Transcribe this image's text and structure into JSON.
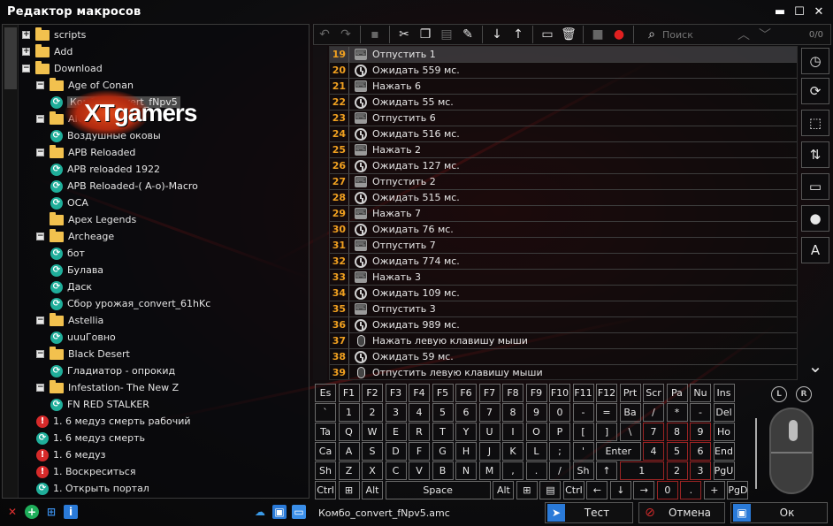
{
  "window": {
    "title": "Редактор макросов",
    "minimize": "▬",
    "maximize": "☐",
    "close": "✕"
  },
  "logo": {
    "text": "XTgamers"
  },
  "tree": {
    "items": [
      {
        "label": "scripts",
        "type": "folder",
        "exp": "+",
        "level": 0
      },
      {
        "label": "Add",
        "type": "folder",
        "exp": "+",
        "level": 0
      },
      {
        "label": "Download",
        "type": "folder",
        "exp": "−",
        "level": 0
      },
      {
        "label": "Age of Conan",
        "type": "folder",
        "exp": "−",
        "level": 1
      },
      {
        "label": "Комбо_convert_fNpv5",
        "type": "macro",
        "level": 2,
        "selected": true
      },
      {
        "label": "AION",
        "type": "folder",
        "exp": "−",
        "level": 1
      },
      {
        "label": "Воздушные оковы",
        "type": "macro",
        "level": 2
      },
      {
        "label": "APB Reloaded",
        "type": "folder",
        "exp": "−",
        "level": 1
      },
      {
        "label": "APB reloaded 1922",
        "type": "macro",
        "level": 2
      },
      {
        "label": "APB Reloaded-( A-o)-Macro",
        "type": "macro",
        "level": 2
      },
      {
        "label": "OCA",
        "type": "macro",
        "level": 2
      },
      {
        "label": "Apex Legends",
        "type": "folder",
        "exp": "",
        "level": 1
      },
      {
        "label": "Archeage",
        "type": "folder",
        "exp": "−",
        "level": 1
      },
      {
        "label": "бот",
        "type": "macro",
        "level": 2
      },
      {
        "label": "Булава",
        "type": "macro",
        "level": 2
      },
      {
        "label": "Даск",
        "type": "macro",
        "level": 2
      },
      {
        "label": "Сбор урожая_convert_61hKc",
        "type": "macro",
        "level": 2
      },
      {
        "label": "Astellia",
        "type": "folder",
        "exp": "−",
        "level": 1
      },
      {
        "label": "uuuГовно",
        "type": "macro",
        "level": 2
      },
      {
        "label": "Black Desert",
        "type": "folder",
        "exp": "−",
        "level": 1
      },
      {
        "label": "Гладиатор - опрокид",
        "type": "macro",
        "level": 2
      },
      {
        "label": "Infestation- The New Z",
        "type": "folder",
        "exp": "−",
        "level": 1
      },
      {
        "label": "FN RED STALKER",
        "type": "macro",
        "level": 2
      },
      {
        "label": "1. 6 медуз смерть рабочий",
        "type": "error",
        "level": 1
      },
      {
        "label": "1. 6 медуз смерть",
        "type": "macro",
        "level": 1
      },
      {
        "label": "1. 6 медуз",
        "type": "error",
        "level": 1
      },
      {
        "label": "1. Воскреситься",
        "type": "error",
        "level": 1
      },
      {
        "label": "1. Открыть портал",
        "type": "macro",
        "level": 1
      }
    ]
  },
  "tree_bottom": {
    "left_icons": [
      "delete-icon",
      "add-icon",
      "network-icon",
      "info-icon"
    ],
    "right_icons": [
      "cloud-upload-icon",
      "save-icon",
      "folder-icon"
    ]
  },
  "toolbar": {
    "search_placeholder": "Поиск",
    "counter": "0/0"
  },
  "list": {
    "rows": [
      {
        "n": "19",
        "kind": "key",
        "text": "Отпустить 1"
      },
      {
        "n": "20",
        "kind": "wait",
        "text": "Ожидать 559 мс."
      },
      {
        "n": "21",
        "kind": "key",
        "text": "Нажать 6"
      },
      {
        "n": "22",
        "kind": "wait",
        "text": "Ожидать 55 мс."
      },
      {
        "n": "23",
        "kind": "key",
        "text": "Отпустить 6"
      },
      {
        "n": "24",
        "kind": "wait",
        "text": "Ожидать 516 мс."
      },
      {
        "n": "25",
        "kind": "key",
        "text": "Нажать 2"
      },
      {
        "n": "26",
        "kind": "wait",
        "text": "Ожидать 127 мс."
      },
      {
        "n": "27",
        "kind": "key",
        "text": "Отпустить 2"
      },
      {
        "n": "28",
        "kind": "wait",
        "text": "Ожидать 515 мс."
      },
      {
        "n": "29",
        "kind": "key",
        "text": "Нажать 7"
      },
      {
        "n": "30",
        "kind": "wait",
        "text": "Ожидать 76 мс."
      },
      {
        "n": "31",
        "kind": "key",
        "text": "Отпустить 7"
      },
      {
        "n": "32",
        "kind": "wait",
        "text": "Ожидать 774 мс."
      },
      {
        "n": "33",
        "kind": "key",
        "text": "Нажать 3"
      },
      {
        "n": "34",
        "kind": "wait",
        "text": "Ожидать 109 мс."
      },
      {
        "n": "35",
        "kind": "key",
        "text": "Отпустить 3"
      },
      {
        "n": "36",
        "kind": "wait",
        "text": "Ожидать 989 мс."
      },
      {
        "n": "37",
        "kind": "mouse",
        "text": "Нажать левую клавишу мыши"
      },
      {
        "n": "38",
        "kind": "wait",
        "text": "Ожидать 59 мс."
      },
      {
        "n": "39",
        "kind": "mouse",
        "text": "Отпустить левую клавишу мыши"
      }
    ]
  },
  "side_buttons": [
    "clock-icon",
    "repeat-icon",
    "loop-icon",
    "cycle-icon",
    "comment-icon",
    "drop-icon",
    "text-size-icon"
  ],
  "keyboard": {
    "rows": [
      [
        "Es",
        "F1",
        "F2",
        "F3",
        "F4",
        "F5",
        "F6",
        "F7",
        "F8",
        "F9",
        "F10",
        "F11",
        "F12",
        "Prt",
        "Scr",
        "Pa",
        "Nu",
        "Ins"
      ],
      [
        "`",
        "1",
        "2",
        "3",
        "4",
        "5",
        "6",
        "7",
        "8",
        "9",
        "0",
        "-",
        "=",
        "Ba",
        "/",
        "*",
        "-",
        "Del"
      ],
      [
        "Ta",
        "Q",
        "W",
        "E",
        "R",
        "T",
        "Y",
        "U",
        "I",
        "O",
        "P",
        "[",
        "]",
        "\\",
        "7",
        "8",
        "9",
        "Ho"
      ],
      [
        "Ca",
        "A",
        "S",
        "D",
        "F",
        "G",
        "H",
        "J",
        "K",
        "L",
        ";",
        "'",
        "Enter",
        "4",
        "5",
        "6",
        "End"
      ],
      [
        "Sh",
        "Z",
        "X",
        "C",
        "V",
        "B",
        "N",
        "M",
        ",",
        ".",
        "/",
        "Sh",
        "↑",
        "1",
        "2",
        "3",
        "PgU"
      ],
      [
        "Ctrl",
        "⊞",
        "Alt",
        "Space",
        "Alt",
        "⊞",
        "▤",
        "Ctrl",
        "←",
        "↓",
        "→",
        "0",
        ".",
        "+",
        "PgD"
      ]
    ]
  },
  "mouse_panel": {
    "left_label": "L",
    "right_label": "R"
  },
  "bottom": {
    "filename": "Комбо_convert_fNpv5.amc",
    "test": "Тест",
    "cancel": "Отмена",
    "ok": "Ок"
  }
}
